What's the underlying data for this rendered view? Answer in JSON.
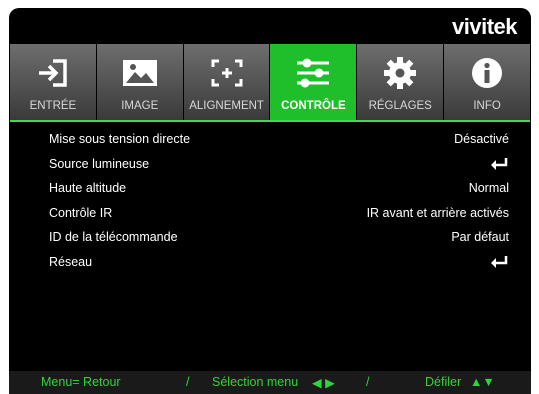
{
  "brand": "vivitek",
  "tabs": [
    {
      "label": "ENTRÉE",
      "icon": "input-icon",
      "active": false
    },
    {
      "label": "IMAGE",
      "icon": "image-icon",
      "active": false
    },
    {
      "label": "ALIGNEMENT",
      "icon": "alignment-icon",
      "active": false
    },
    {
      "label": "CONTRÔLE",
      "icon": "control-sliders-icon",
      "active": true
    },
    {
      "label": "RÉGLAGES",
      "icon": "gear-icon",
      "active": false
    },
    {
      "label": "INFO",
      "icon": "info-icon",
      "active": false
    }
  ],
  "menu": [
    {
      "name": "Mise sous tension directe",
      "value": "Désactivé"
    },
    {
      "name": "Source lumineuse",
      "value": "",
      "submenu_icon": "enter-icon"
    },
    {
      "name": "Haute altitude",
      "value": "Normal"
    },
    {
      "name": "Contrôle IR",
      "value": "IR avant et arrière activés"
    },
    {
      "name": "ID de la télécommande",
      "value": "Par défaut"
    },
    {
      "name": "Réseau",
      "value": "",
      "submenu_icon": "enter-icon"
    }
  ],
  "footer": {
    "back": "Menu= Retour",
    "sep1": "/",
    "select": "Sélection menu",
    "select_arrows": "◀ ▶",
    "sep2": "/",
    "scroll": "Défiler",
    "scroll_arrows": "▲▼"
  },
  "colors": {
    "accent": "#1fbf2b",
    "footer_text": "#2fd33b",
    "background": "#000000"
  }
}
